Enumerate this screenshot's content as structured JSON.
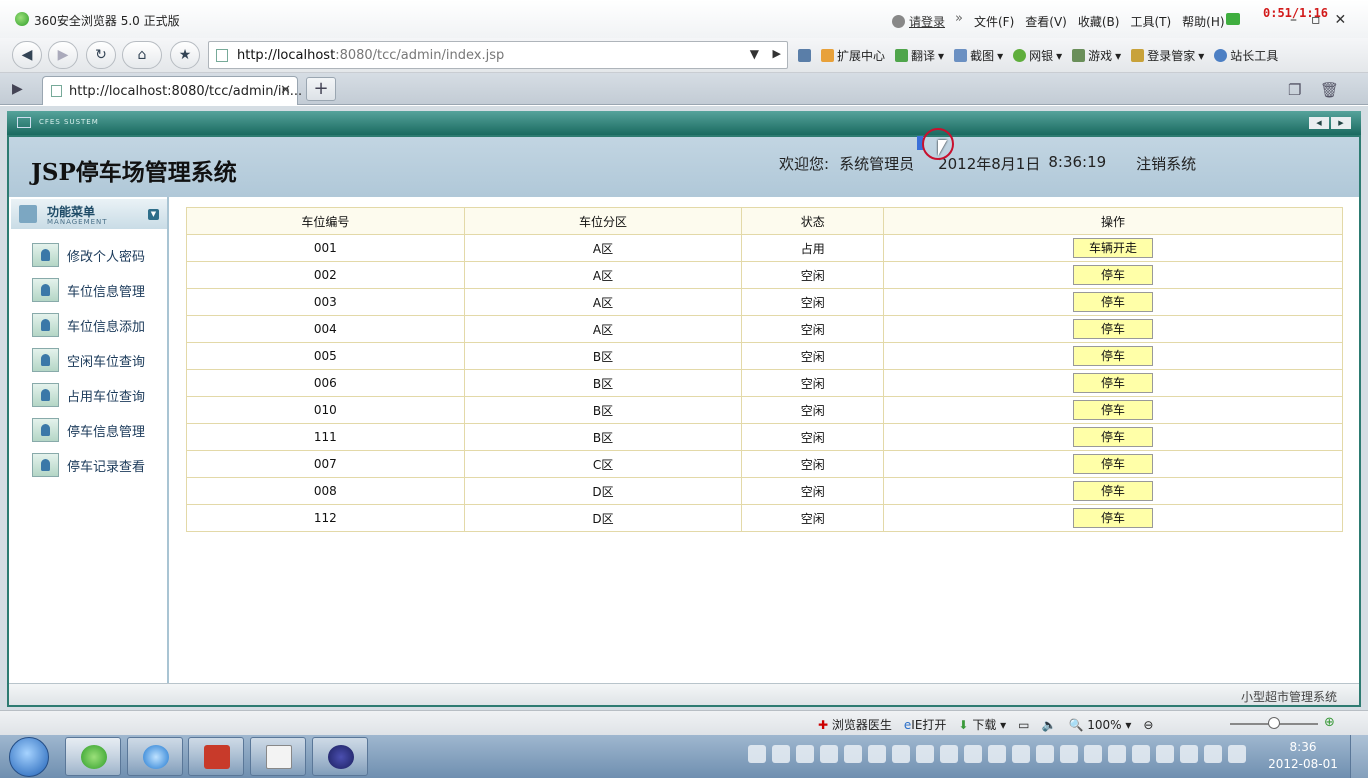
{
  "browser": {
    "app_title": "360安全浏览器 5.0 正式版",
    "login_link": "请登录",
    "menus": [
      "文件(F)",
      "查看(V)",
      "收藏(B)",
      "工具(T)",
      "帮助(H)"
    ],
    "recording_timer": "0:51/1:16",
    "url_host": "http://localhost",
    "url_rest": ":8080/tcc/admin/index.jsp",
    "toolbar": [
      "扩展中心",
      "翻译",
      "截图",
      "网银",
      "游戏",
      "登录管家",
      "站长工具"
    ],
    "tab_title": "http://localhost:8080/tcc/admin/in...",
    "status_items": [
      "浏览器医生",
      "IE打开",
      "下载",
      "100%"
    ]
  },
  "page": {
    "sysbar_logo": "CFES SUSTEM",
    "title": "JSP停车场管理系统",
    "welcome_label": "欢迎您:",
    "user_name": "系统管理员",
    "date": "2012年8月1日",
    "time": "8:36:19",
    "logout": "注销系统",
    "menu_title": "功能菜单",
    "menu_subtitle": "MANAGEMENT",
    "menu_items": [
      "修改个人密码",
      "车位信息管理",
      "车位信息添加",
      "空闲车位查询",
      "占用车位查询",
      "停车信息管理",
      "停车记录查看"
    ],
    "table": {
      "headers": [
        "车位编号",
        "车位分区",
        "状态",
        "操作"
      ],
      "rows": [
        {
          "id": "001",
          "zone": "A区",
          "status": "占用",
          "action": "车辆开走"
        },
        {
          "id": "002",
          "zone": "A区",
          "status": "空闲",
          "action": "停车"
        },
        {
          "id": "003",
          "zone": "A区",
          "status": "空闲",
          "action": "停车"
        },
        {
          "id": "004",
          "zone": "A区",
          "status": "空闲",
          "action": "停车"
        },
        {
          "id": "005",
          "zone": "B区",
          "status": "空闲",
          "action": "停车"
        },
        {
          "id": "006",
          "zone": "B区",
          "status": "空闲",
          "action": "停车"
        },
        {
          "id": "010",
          "zone": "B区",
          "status": "空闲",
          "action": "停车"
        },
        {
          "id": "111",
          "zone": "B区",
          "status": "空闲",
          "action": "停车"
        },
        {
          "id": "007",
          "zone": "C区",
          "status": "空闲",
          "action": "停车"
        },
        {
          "id": "008",
          "zone": "D区",
          "status": "空闲",
          "action": "停车"
        },
        {
          "id": "112",
          "zone": "D区",
          "status": "空闲",
          "action": "停车"
        }
      ]
    },
    "footer": "小型超市管理系统"
  },
  "taskbar": {
    "clock_time": "8:36",
    "clock_date": "2012-08-01"
  },
  "colors": {
    "occupied": "#cc0000",
    "button_bg": "#ffffa8",
    "header_bg": "#b9cfdd",
    "sysbar": "#1a6a60"
  }
}
